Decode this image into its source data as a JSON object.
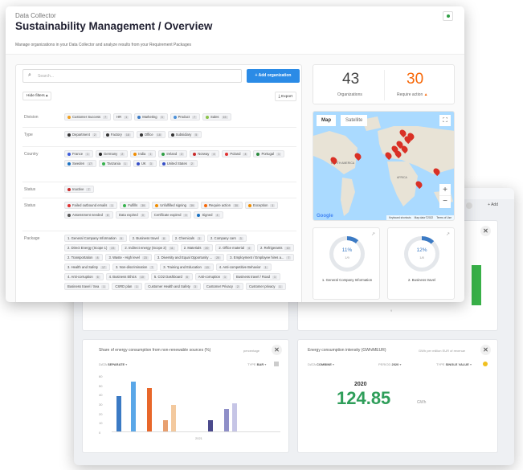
{
  "back": {
    "top_right_add": "+ Add",
    "card1": {
      "title": "Share of energy consumption from non-renewable sources (%)",
      "subtitle": "percentage",
      "filter1_label": "DATA",
      "filter1_value": "SEPARATE",
      "filter2_label": "TYPE",
      "filter2_value": "BAR",
      "y_ticks": [
        "60",
        "50",
        "40",
        "30",
        "20",
        "10",
        "0"
      ],
      "x_label": "2021"
    },
    "card2": {
      "title": "Energy consumption intensity (GWh/MEUR)",
      "subtitle": "GWh per million EUR of revenue",
      "filter1_label": "DATA",
      "filter1_value": "COMBINE",
      "filter2_label": "PERIOD",
      "filter2_value": "2020",
      "filter3_label": "TYPE",
      "filter3_value": "SINGLE VALUE",
      "year": "2020",
      "value": "124.85",
      "unit": "GWh"
    },
    "chart_data": {
      "type": "bar",
      "categories": [
        "2021"
      ],
      "series": [
        {
          "values": [
            38
          ],
          "color": "#3b7ac4"
        },
        {
          "values": [
            53
          ],
          "color": "#5aa7e8"
        },
        {
          "values": [
            46
          ],
          "color": "#e8672a"
        },
        {
          "values": [
            12
          ],
          "color": "#e8a070"
        },
        {
          "values": [
            28
          ],
          "color": "#f3c99e"
        },
        {
          "values": [
            12
          ],
          "color": "#4b4a8c"
        },
        {
          "values": [
            24
          ],
          "color": "#8f8fc8"
        },
        {
          "values": [
            30
          ],
          "color": "#c6c5e6"
        }
      ],
      "ylim": [
        0,
        60
      ]
    },
    "side_number": "9"
  },
  "front": {
    "app_name": "Data Collector",
    "title": "Sustainability Management / Overview",
    "subtitle": "Manage organizations in your Data Collector and analyze results from your Requirement Packages",
    "search_placeholder": "Search...",
    "add_org_label": "+ Add organization",
    "hide_filters": "Hide filters",
    "export": "Export",
    "stats": {
      "org_count": "43",
      "org_label": "Organizations",
      "req_count": "30",
      "req_label": "Require action"
    },
    "map": {
      "tab_map": "Map",
      "tab_satellite": "Satellite",
      "label_na": "NORTH AMERICA",
      "label_africa": "AFRICA",
      "footer": [
        "Keyboard shortcuts",
        "Map data ©2022",
        "Terms of Use"
      ],
      "google": "Google"
    },
    "donuts": [
      {
        "pct": "11%",
        "frac": "1/9",
        "label": "1. General Company Information",
        "value": 0.11
      },
      {
        "pct": "12%",
        "frac": "1/8",
        "label": "2. Business travel",
        "value": 0.12
      }
    ],
    "filters": [
      {
        "label": "Division",
        "chips": [
          {
            "t": "Customer Success",
            "c": "7",
            "dot": "#f0a020"
          },
          {
            "t": "HR",
            "c": "1"
          },
          {
            "t": "Marketing",
            "c": "3",
            "dot": "#3b7ac4"
          },
          {
            "t": "Product",
            "c": "7",
            "dot": "#4a90d9"
          },
          {
            "t": "Sales",
            "c": "15",
            "dot": "#8bc34a"
          }
        ]
      },
      {
        "label": "Type",
        "chips": [
          {
            "t": "Department",
            "c": "2",
            "dot": "#333"
          },
          {
            "t": "Factory",
            "c": "18",
            "dot": "#333"
          },
          {
            "t": "Office",
            "c": "18",
            "dot": "#333"
          },
          {
            "t": "Subsidiary",
            "c": "5",
            "dot": "#333"
          }
        ]
      },
      {
        "label": "Country",
        "chips": [
          {
            "t": "France",
            "c": "1",
            "dot": "#3b5bdb"
          },
          {
            "t": "Germany",
            "c": "2",
            "dot": "#222"
          },
          {
            "t": "India",
            "c": "1",
            "dot": "#f08c00"
          },
          {
            "t": "Ireland",
            "c": "2",
            "dot": "#2f9e44"
          },
          {
            "t": "Norway",
            "c": "4",
            "dot": "#c92a2a"
          },
          {
            "t": "Poland",
            "c": "4",
            "dot": "#e03131"
          },
          {
            "t": "Portugal",
            "c": "1",
            "dot": "#2b8a3e"
          },
          {
            "t": "Sweden",
            "c": "17",
            "dot": "#1971c2"
          },
          {
            "t": "Tanzania",
            "c": "1",
            "dot": "#37b24d"
          },
          {
            "t": "UK",
            "c": "3",
            "dot": "#364fc7"
          },
          {
            "t": "United States",
            "c": "2",
            "dot": "#364fc7"
          }
        ]
      },
      {
        "label": "Status",
        "chips": [
          {
            "t": "Inactive",
            "c": "7",
            "dot": "#c92a2a"
          }
        ]
      },
      {
        "label": "Status",
        "chips": [
          {
            "t": "Failed outbound emails",
            "c": "1",
            "dot": "#e03131"
          },
          {
            "t": "Fulfills",
            "c": "39",
            "dot": "#37b24d"
          },
          {
            "t": "Unfulfilled signing",
            "c": "39",
            "dot": "#f08c00"
          },
          {
            "t": "Require action",
            "c": "30",
            "dot": "#f76707"
          },
          {
            "t": "Exception",
            "c": "1",
            "dot": "#f08c00"
          },
          {
            "t": "Assessment needed",
            "c": "8",
            "dot": "#555"
          },
          {
            "t": "Data expired",
            "c": "0"
          },
          {
            "t": "Certificate expired",
            "c": "0"
          },
          {
            "t": "Signed",
            "c": "4",
            "dot": "#1971c2"
          }
        ]
      },
      {
        "label": "Package",
        "chips": [
          {
            "t": "1. General Company Information",
            "c": "9"
          },
          {
            "t": "2. Business travel",
            "c": "8"
          },
          {
            "t": "2. Chemicals",
            "c": "3"
          },
          {
            "t": "2. Company cars",
            "c": "3"
          },
          {
            "t": "2. Direct Energy (Scope 1)",
            "c": "23"
          },
          {
            "t": "2. Indirect energy (Scope 2)",
            "c": "11"
          },
          {
            "t": "2. Materials",
            "c": "20"
          },
          {
            "t": "2. Office material",
            "c": "4"
          },
          {
            "t": "2. Refrigerants",
            "c": "10"
          },
          {
            "t": "2. Transportation",
            "c": "8"
          },
          {
            "t": "3. Waste - High level",
            "c": "23"
          },
          {
            "t": "3. Diversity and Equal Opportunity ...",
            "c": "20"
          },
          {
            "t": "3. Employment / Employee hires a...",
            "c": "7"
          },
          {
            "t": "3. Health and Safety",
            "c": "17"
          },
          {
            "t": "3. Non-discrimination",
            "c": "7"
          },
          {
            "t": "3. Training and Education",
            "c": "10"
          },
          {
            "t": "4. Anti-competitive Behavior",
            "c": "1"
          },
          {
            "t": "4. Anti-corruption",
            "c": "6"
          },
          {
            "t": "4. Business Ethics",
            "c": "10"
          },
          {
            "t": "5. CO2 Dashboard",
            "c": "8"
          },
          {
            "t": "Anti-corruption",
            "c": "1"
          },
          {
            "t": "Business travel / Road",
            "c": "1"
          },
          {
            "t": "Business travel / Sea",
            "c": "1"
          },
          {
            "t": "CSRD plan",
            "c": "1"
          },
          {
            "t": "Customer Health and Safety",
            "c": "3"
          },
          {
            "t": "Customer Privacy",
            "c": "2"
          },
          {
            "t": "Customer privacy",
            "c": "1"
          }
        ]
      }
    ]
  }
}
